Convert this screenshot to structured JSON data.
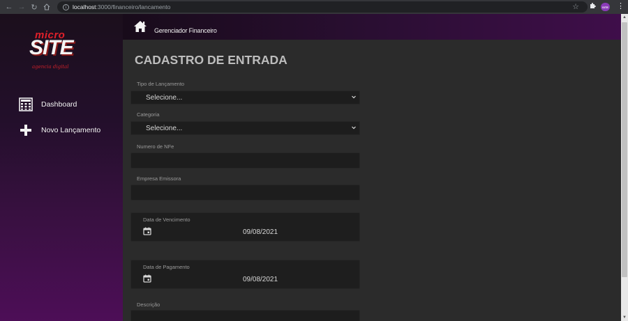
{
  "browser": {
    "url_host": "localhost",
    "url_path": ":3000/financeiro/lancamento",
    "profile_badge": "SITE"
  },
  "sidebar": {
    "logo": {
      "micro": "micro",
      "site": "SITE",
      "tagline": "agencia digital"
    },
    "items": [
      {
        "label": "Dashboard",
        "icon": "calculator-icon"
      },
      {
        "label": "Novo Lançamento",
        "icon": "plus-icon"
      }
    ]
  },
  "header": {
    "title": "Gerenciador Financeiro",
    "icon": "home-icon"
  },
  "form": {
    "page_title": "CADASTRO DE ENTRADA",
    "tipo_lancamento": {
      "label": "Tipo de Lançamento",
      "value": "Selecione..."
    },
    "categoria": {
      "label": "Categoria",
      "value": "Selecione..."
    },
    "numero_nfe": {
      "label": "Numero de NFe",
      "value": ""
    },
    "empresa_emissora": {
      "label": "Empresa Emissora",
      "value": ""
    },
    "data_vencimento": {
      "label": "Data de Vencimento",
      "value": "09/08/2021"
    },
    "data_pagamento": {
      "label": "Data de Pagamento",
      "value": "09/08/2021"
    },
    "descricao": {
      "label": "Descrição",
      "value": ""
    }
  },
  "colors": {
    "accent_red": "#e0202a",
    "sidebar_bottom": "#4d0e57",
    "panel_bg": "#2b2b2b",
    "input_bg": "#1d1d1d"
  }
}
